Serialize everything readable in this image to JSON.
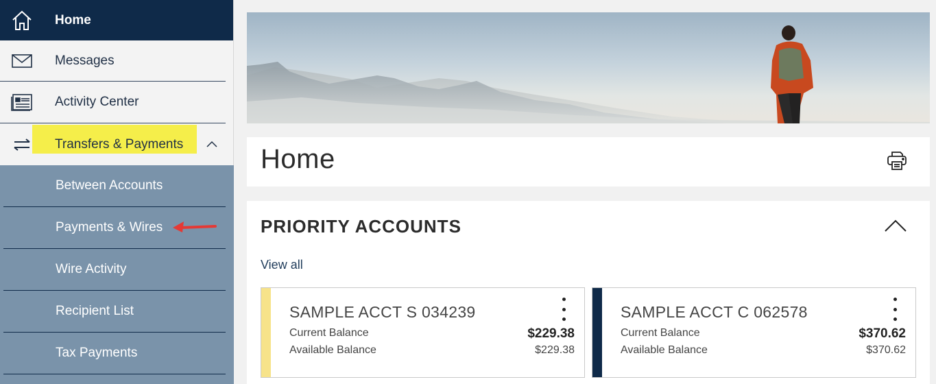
{
  "sidebar": {
    "items": [
      {
        "label": "Home",
        "icon": "home-icon"
      },
      {
        "label": "Messages",
        "icon": "envelope-icon"
      },
      {
        "label": "Activity Center",
        "icon": "activity-list-icon"
      },
      {
        "label": "Transfers & Payments",
        "icon": "transfer-arrows-icon",
        "expanded": true,
        "highlighted": true
      }
    ],
    "subitems": [
      {
        "label": "Between Accounts"
      },
      {
        "label": "Payments & Wires",
        "annotated": true
      },
      {
        "label": "Wire Activity"
      },
      {
        "label": "Recipient List"
      },
      {
        "label": "Tax Payments"
      }
    ]
  },
  "main": {
    "page_title": "Home",
    "priority": {
      "title": "PRIORITY ACCOUNTS",
      "view_all": "View all",
      "accounts": [
        {
          "name": "SAMPLE ACCT S 034239",
          "current_label": "Current Balance",
          "current": "$229.38",
          "available_label": "Available Balance",
          "available": "$229.38",
          "color": "#f7e38a"
        },
        {
          "name": "SAMPLE ACCT C 062578",
          "current_label": "Current Balance",
          "current": "$370.62",
          "available_label": "Available Balance",
          "available": "$370.62",
          "color": "#0f2a49"
        }
      ]
    }
  },
  "colors": {
    "nav_active": "#0f2a49",
    "subnav_bg": "#7a93aa",
    "highlight": "#f5ee4a",
    "annotation_arrow": "#e53935"
  }
}
